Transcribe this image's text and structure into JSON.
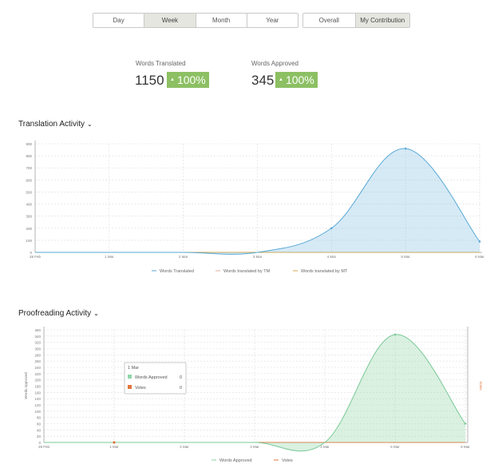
{
  "period_tabs": [
    "Day",
    "Week",
    "Month",
    "Year"
  ],
  "period_active": "Week",
  "scope_tabs": [
    "Overall",
    "My Contribution"
  ],
  "scope_active": "My Contribution",
  "stats": {
    "translated_label": "Words Translated",
    "translated_value": "1150",
    "translated_pct": "100%",
    "approved_label": "Words Approved",
    "approved_value": "345",
    "approved_pct": "100%",
    "badge_arrow": "▲"
  },
  "colors": {
    "badge": "#8cc063",
    "translated": "#5aa9d6",
    "approved": "#8fd6a8",
    "votes": "#e0763c",
    "tm": "#e7a99b",
    "mt": "#d6a74a"
  },
  "translation": {
    "title": "Translation Activity",
    "chevron_icon": "chevron-down-icon"
  },
  "proofreading": {
    "title": "Proofreading Activity",
    "chevron_icon": "chevron-down-icon",
    "tooltip": {
      "date": "1 Mar",
      "rows": [
        {
          "label": "Words Approved",
          "value": "0"
        },
        {
          "label": "Votes",
          "value": "0"
        }
      ]
    }
  },
  "chart_data": [
    {
      "type": "area",
      "title": "Translation Activity",
      "x": [
        "28 Feb",
        "1 Mar",
        "2 Mar",
        "3 Mar",
        "4 Mar",
        "5 Mar",
        "6 Mar"
      ],
      "ylim": [
        0,
        900
      ],
      "yticks": [
        0,
        100,
        200,
        300,
        400,
        500,
        600,
        700,
        800,
        900
      ],
      "series": [
        {
          "name": "Words Translated",
          "values": [
            0,
            0,
            0,
            0,
            200,
            860,
            90
          ]
        },
        {
          "name": "Words translated by TM",
          "values": [
            0,
            0,
            0,
            0,
            0,
            0,
            0
          ]
        },
        {
          "name": "Words translated by MT",
          "values": [
            0,
            0,
            0,
            0,
            0,
            0,
            0
          ]
        }
      ],
      "grid": true,
      "legend": "bottom"
    },
    {
      "type": "area",
      "title": "Proofreading Activity",
      "ylabel": "Words Approved",
      "y2label": "Votes",
      "x": [
        "28 Feb",
        "1 Mar",
        "2 Mar",
        "3 Mar",
        "4 Mar",
        "5 Mar",
        "6 Mar"
      ],
      "ylim": [
        0,
        360
      ],
      "yticks": [
        0,
        20,
        40,
        60,
        80,
        100,
        120,
        140,
        160,
        180,
        200,
        220,
        240,
        260,
        280,
        300,
        320,
        340,
        360
      ],
      "series": [
        {
          "name": "Words Approved",
          "values": [
            0,
            0,
            0,
            0,
            0,
            345,
            60
          ]
        },
        {
          "name": "Votes",
          "values": [
            0,
            0,
            0,
            0,
            0,
            0,
            0
          ]
        }
      ],
      "grid": true,
      "legend": "bottom"
    }
  ]
}
